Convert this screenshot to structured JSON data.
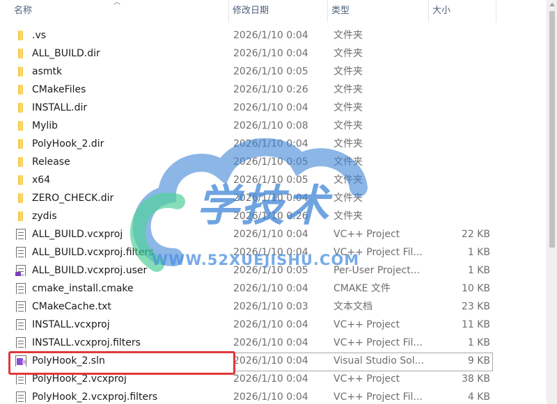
{
  "columns": {
    "name": "名称",
    "date": "修改日期",
    "type": "类型",
    "size": "大小"
  },
  "files": [
    {
      "icon": "folder-icon",
      "name": ".vs",
      "date": "2026/1/10 0:04",
      "type": "文件夹",
      "size": ""
    },
    {
      "icon": "folder-icon",
      "name": "ALL_BUILD.dir",
      "date": "2026/1/10 0:04",
      "type": "文件夹",
      "size": ""
    },
    {
      "icon": "folder-icon",
      "name": "asmtk",
      "date": "2026/1/10 0:05",
      "type": "文件夹",
      "size": ""
    },
    {
      "icon": "folder-icon",
      "name": "CMakeFiles",
      "date": "2026/1/10 0:26",
      "type": "文件夹",
      "size": ""
    },
    {
      "icon": "folder-icon",
      "name": "INSTALL.dir",
      "date": "2026/1/10 0:04",
      "type": "文件夹",
      "size": ""
    },
    {
      "icon": "folder-icon",
      "name": "Mylib",
      "date": "2026/1/10 0:08",
      "type": "文件夹",
      "size": ""
    },
    {
      "icon": "folder-icon",
      "name": "PolyHook_2.dir",
      "date": "2026/1/10 0:04",
      "type": "文件夹",
      "size": ""
    },
    {
      "icon": "folder-icon",
      "name": "Release",
      "date": "2026/1/10 0:05",
      "type": "文件夹",
      "size": ""
    },
    {
      "icon": "folder-icon",
      "name": "x64",
      "date": "2026/1/10 0:05",
      "type": "文件夹",
      "size": ""
    },
    {
      "icon": "folder-icon",
      "name": "ZERO_CHECK.dir",
      "date": "2026/1/10 0:04",
      "type": "文件夹",
      "size": ""
    },
    {
      "icon": "folder-icon",
      "name": "zydis",
      "date": "2026/1/10 0:26",
      "type": "文件夹",
      "size": ""
    },
    {
      "icon": "vcxproj-icon",
      "name": "ALL_BUILD.vcxproj",
      "date": "2026/1/10 0:04",
      "type": "VC++ Project",
      "size": "22 KB"
    },
    {
      "icon": "filters-icon",
      "name": "ALL_BUILD.vcxproj.filters",
      "date": "2026/1/10 0:04",
      "type": "VC++ Project Fil...",
      "size": "1 KB"
    },
    {
      "icon": "user-file-icon",
      "name": "ALL_BUILD.vcxproj.user",
      "date": "2026/1/10 0:05",
      "type": "Per-User Project...",
      "size": "1 KB"
    },
    {
      "icon": "document-icon",
      "name": "cmake_install.cmake",
      "date": "2026/1/10 0:04",
      "type": "CMAKE 文件",
      "size": "10 KB"
    },
    {
      "icon": "text-file-icon",
      "name": "CMakeCache.txt",
      "date": "2026/1/10 0:03",
      "type": "文本文档",
      "size": "23 KB"
    },
    {
      "icon": "vcxproj-icon",
      "name": "INSTALL.vcxproj",
      "date": "2026/1/10 0:04",
      "type": "VC++ Project",
      "size": "11 KB"
    },
    {
      "icon": "filters-icon",
      "name": "INSTALL.vcxproj.filters",
      "date": "2026/1/10 0:04",
      "type": "VC++ Project Fil...",
      "size": "1 KB"
    },
    {
      "icon": "solution-icon",
      "name": "PolyHook_2.sln",
      "date": "2026/1/10 0:04",
      "type": "Visual Studio Sol...",
      "size": "9 KB",
      "highlighted": true
    },
    {
      "icon": "vcxproj-icon",
      "name": "PolyHook_2.vcxproj",
      "date": "2026/1/10 0:04",
      "type": "VC++ Project",
      "size": "38 KB"
    },
    {
      "icon": "filters-icon",
      "name": "PolyHook_2.vcxproj.filters",
      "date": "2026/1/10 0:04",
      "type": "VC++ Project Fil...",
      "size": "4 KB"
    }
  ],
  "watermark": {
    "text": "学技术",
    "url": "WWW.52XUEJISHU.COM"
  },
  "colors": {
    "highlight_border": "#e0393c",
    "folder": "#f3c54a",
    "header_text": "#4c607a",
    "watermark_blue": "#3f86d6",
    "watermark_green": "#34c98a"
  }
}
